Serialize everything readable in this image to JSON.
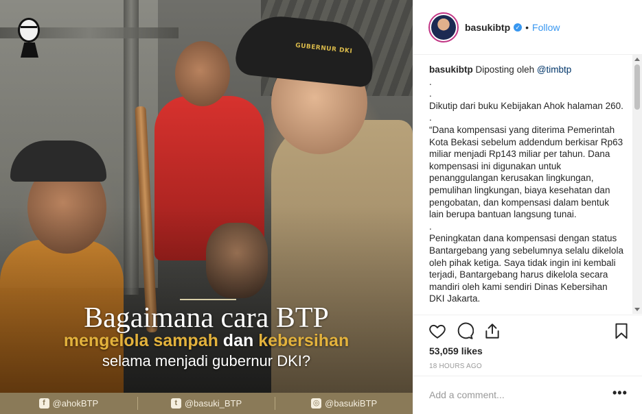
{
  "photo": {
    "cap_text": "GUBERNUR DKI",
    "headline_line1": "Bagaimana cara BTP",
    "headline_line2_gold_a": "mengelola sampah",
    "headline_line2_white": " dan ",
    "headline_line2_gold_b": "kebersihan",
    "headline_line3": "selama menjadi gubernur DKI?",
    "footer": [
      {
        "icon": "facebook-icon",
        "glyph": "f",
        "label": "@ahokBTP"
      },
      {
        "icon": "twitter-icon",
        "glyph": "t",
        "label": "@basuki_BTP"
      },
      {
        "icon": "instagram-icon",
        "glyph": "◎",
        "label": "@basukiBTP"
      }
    ]
  },
  "header": {
    "username": "basukibtp",
    "separator": "•",
    "follow_label": "Follow"
  },
  "caption": {
    "username": "basukibtp",
    "intro": "Diposting oleh ",
    "mention": "@timbtp",
    "body": "\n.\n.\nDikutip dari buku Kebijakan Ahok halaman 260. .\n“Dana kompensasi yang diterima Pemerintah Kota Bekasi sebelum addendum berkisar Rp63 miliar menjadi Rp143 miliar per tahun. Dana kompensasi ini digunakan untuk penanggulangan kerusakan lingkungan, pemulihan lingkungan, biaya kesehatan dan pengobatan, dan kompensasi dalam bentuk lain berupa bantuan langsung tunai.\n.\nPeningkatan dana kompensasi dengan status Bantargebang yang sebelumnya selalu dikelola oleh pihak ketiga. Saya tidak ingin ini kembali terjadi, Bantargebang harus dikelola secara mandiri oleh kami sendiri Dinas Kebersihan DKI Jakarta."
  },
  "actions": {
    "likes": "53,059 likes",
    "time": "18 HOURS AGO",
    "comment_placeholder": "Add a comment...",
    "more_label": "•••"
  },
  "colors": {
    "accent": "#3897f0",
    "gold": "#e3b23c",
    "footer_bar": "#8a7a58"
  }
}
